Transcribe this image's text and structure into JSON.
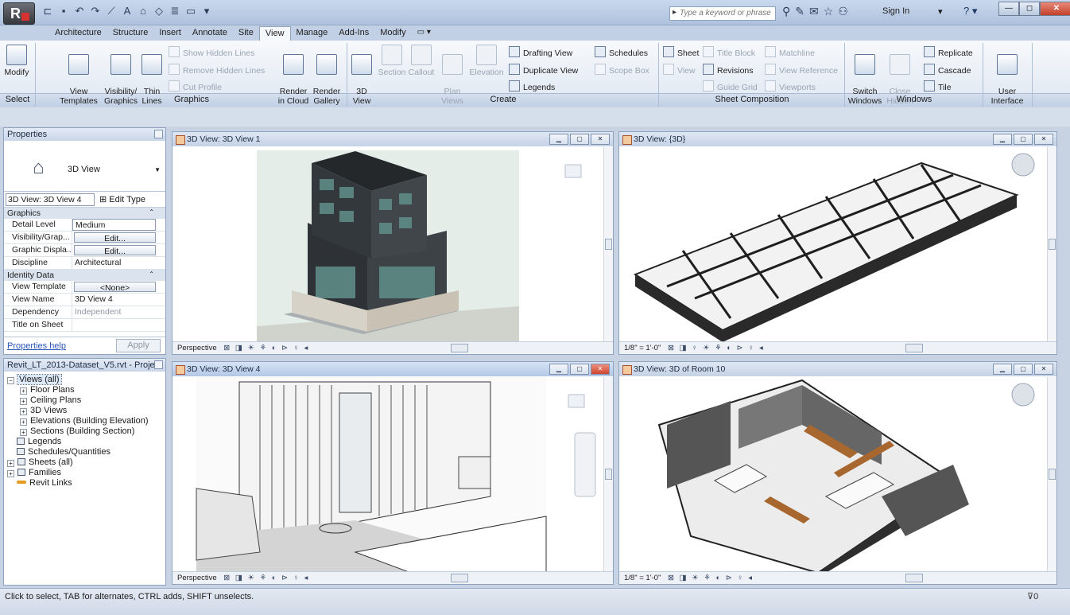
{
  "titlebar": {
    "app_letter": "R",
    "search_placeholder": "Type a keyword or phrase",
    "sign_in": "Sign In",
    "qat_icons": [
      "open-icon",
      "save-icon",
      "undo-icon",
      "redo-icon",
      "measure-icon",
      "text-icon",
      "3d-icon",
      "section-icon",
      "thin-lines-icon",
      "close-hidden-icon",
      "switch-windows-icon"
    ],
    "help_glyph": "?"
  },
  "tabs": [
    "Architecture",
    "Structure",
    "Insert",
    "Annotate",
    "Site",
    "View",
    "Manage",
    "Add-Ins",
    "Modify"
  ],
  "active_tab": "View",
  "ribbon": {
    "select_panel": {
      "label": "Select",
      "modify": "Modify"
    },
    "graphics_panel": {
      "label": "Graphics",
      "view_templates": "View\nTemplates",
      "visibility_graphics": "Visibility/\nGraphics",
      "thin_lines": "Thin\nLines",
      "show_hidden": "Show Hidden Lines",
      "remove_hidden": "Remove Hidden Lines",
      "cut_profile": "Cut Profile",
      "render_cloud": "Render\nin Cloud",
      "render_gallery": "Render\nGallery"
    },
    "create_panel": {
      "label": "Create",
      "view3d": "3D\nView",
      "section": "Section",
      "callout": "Callout",
      "plan_views": "Plan\nViews",
      "elevation": "Elevation",
      "drafting_view": "Drafting View",
      "duplicate_view": "Duplicate View",
      "legends": "Legends",
      "schedules": "Schedules",
      "scope_box": "Scope Box"
    },
    "sheet_panel": {
      "label": "Sheet Composition",
      "sheet": "Sheet",
      "view": "View",
      "title_block": "Title Block",
      "revisions": "Revisions",
      "guide_grid": "Guide Grid",
      "matchline": "Matchline",
      "view_reference": "View Reference",
      "viewports": "Viewports"
    },
    "windows_panel": {
      "label": "Windows",
      "switch_windows": "Switch\nWindows",
      "close_hidden": "Close\nHidden",
      "replicate": "Replicate",
      "cascade": "Cascade",
      "tile": "Tile",
      "user_interface": "User\nInterface"
    }
  },
  "properties": {
    "title": "Properties",
    "type_name": "3D View",
    "instance_selector": "3D View: 3D View 4",
    "edit_type": "Edit Type",
    "groups": [
      {
        "name": "Graphics",
        "rows": [
          {
            "k": "Detail Level",
            "v": "Medium",
            "style": "box"
          },
          {
            "k": "Visibility/Grap...",
            "v": "Edit...",
            "style": "btn"
          },
          {
            "k": "Graphic Displa...",
            "v": "Edit...",
            "style": "btn"
          },
          {
            "k": "Discipline",
            "v": "Architectural",
            "style": "plain"
          }
        ]
      },
      {
        "name": "Identity Data",
        "rows": [
          {
            "k": "View Template",
            "v": "<None>",
            "style": "btn"
          },
          {
            "k": "View Name",
            "v": "3D View 4",
            "style": "plain"
          },
          {
            "k": "Dependency",
            "v": "Independent",
            "style": "grey"
          },
          {
            "k": "Title on Sheet",
            "v": "",
            "style": "plain"
          }
        ]
      }
    ],
    "help": "Properties help",
    "apply": "Apply"
  },
  "browser": {
    "title": "Revit_LT_2013-Dataset_V5.rvt - Proje...",
    "items": [
      {
        "label": "Views (all)",
        "level": 0,
        "exp": "-",
        "selected": true
      },
      {
        "label": "Floor Plans",
        "level": 1,
        "exp": "+"
      },
      {
        "label": "Ceiling Plans",
        "level": 1,
        "exp": "+"
      },
      {
        "label": "3D Views",
        "level": 1,
        "exp": "+"
      },
      {
        "label": "Elevations (Building Elevation)",
        "level": 1,
        "exp": "+"
      },
      {
        "label": "Sections (Building Section)",
        "level": 1,
        "exp": "+"
      },
      {
        "label": "Legends",
        "level": 2,
        "icon": "legend"
      },
      {
        "label": "Schedules/Quantities",
        "level": 2,
        "icon": "schedule"
      },
      {
        "label": "Sheets (all)",
        "level": 0,
        "exp": "+",
        "icon": "sheet"
      },
      {
        "label": "Families",
        "level": 0,
        "exp": "+",
        "icon": "family"
      },
      {
        "label": "Revit Links",
        "level": 2,
        "icon": "link"
      }
    ]
  },
  "views": [
    {
      "title": "3D View: 3D View 1",
      "scale": "Perspective"
    },
    {
      "title": "3D View: {3D}",
      "scale": "1/8\" = 1'-0\""
    },
    {
      "title": "3D View: 3D View 4",
      "scale": "Perspective",
      "active": true
    },
    {
      "title": "3D View: 3D of Room 10",
      "scale": "1/8\" = 1'-0\""
    }
  ],
  "status": {
    "text": "Click to select, TAB for alternates, CTRL adds, SHIFT unselects.",
    "filter": "0"
  },
  "colors": {
    "ribbon_bg": "#dfe7f2",
    "accent": "#8ea3c0",
    "close_red": "#c2412b"
  }
}
